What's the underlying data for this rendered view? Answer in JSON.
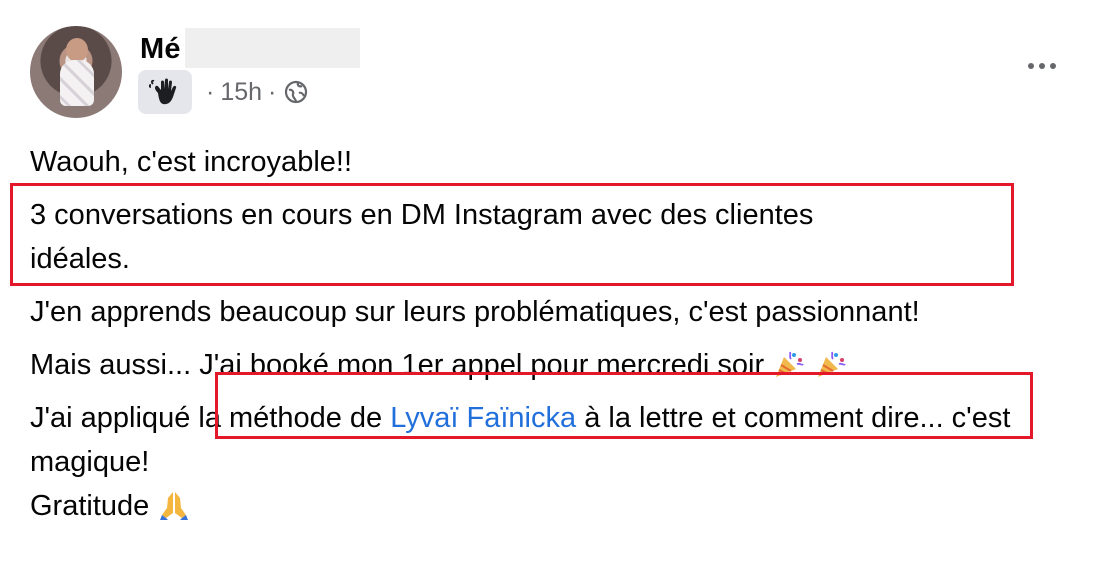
{
  "post": {
    "author_name_visible": "Mé",
    "time": "15h",
    "separator": "·",
    "more_icon": "more-horizontal-icon",
    "audience_icon": "globe-icon",
    "badge_icon": "raised-hand-icon",
    "paragraphs": {
      "p1": "Waouh, c'est incroyable!!",
      "p2_line1": "3 conversations en cours en DM Instagram avec des clientes",
      "p2_line2": "idéales.",
      "p3": "J'en apprends beaucoup sur leurs problématiques, c'est passionnant!",
      "p4_prefix": "Mais aussi...",
      "p4_main": "J'ai booké mon 1er appel pour mercredi soir",
      "p5_before": "J'ai appliqué la méthode de ",
      "p5_mention": "Lyvaï Faïnicka",
      "p5_after": " à la lettre et comment dire... c'est magique!",
      "p6": "Gratitude"
    },
    "emojis": {
      "party": "party-popper-icon",
      "pray": "folded-hands-icon"
    },
    "highlight_color": "#e3182a",
    "mention_color": "#216fdb"
  }
}
